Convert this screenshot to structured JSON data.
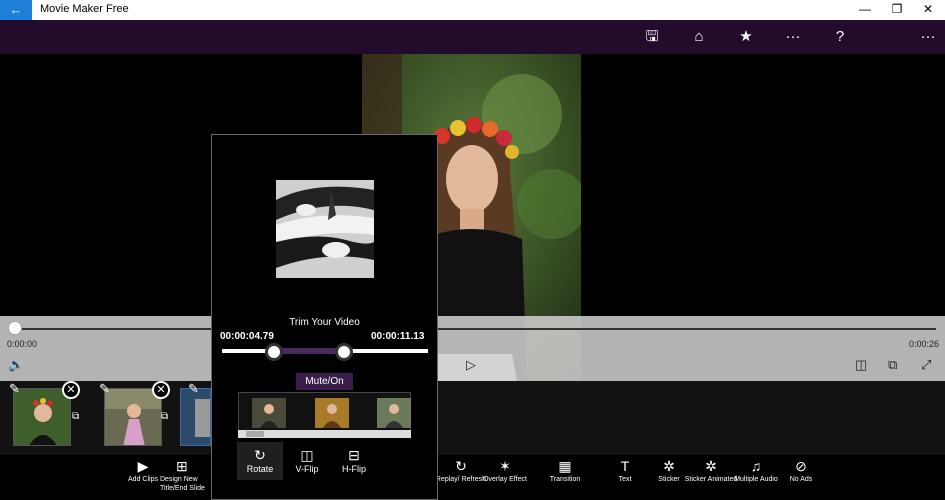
{
  "window": {
    "title": "Movie Maker Free",
    "back_icon": "←",
    "minimize": "—",
    "restore": "❐",
    "close": "✕"
  },
  "toolbar": {
    "save_icon": "🖫",
    "home_icon": "⌂",
    "star_icon": "★",
    "more_icon": "···",
    "help_icon": "?",
    "overflow_icon": "···"
  },
  "timeline": {
    "current_time": "0:00:00",
    "total_time": "0:00:26",
    "progress": 0.0,
    "volume_icon": "🔊",
    "play_icon": "▷",
    "split_icon": "◫",
    "export_icon": "⧉",
    "fullscreen_icon": "⤢"
  },
  "clips": {
    "remove_icon": "✕",
    "edit_icon": "✎",
    "copy_icon": "⧉"
  },
  "trim_dialog": {
    "title": "Trim Your Video",
    "start_time": "00:00:04.79",
    "end_time": "00:00:11.13",
    "mute_label": "Mute/On",
    "rotate_label": "Rotate",
    "vflip_label": "V-Flip",
    "hflip_label": "H-Flip",
    "rotate_icon": "↻",
    "vflip_icon": "◫",
    "hflip_icon": "⊟"
  },
  "bottom_bar": {
    "items": [
      {
        "label": "Add Clips",
        "icon": "▶"
      },
      {
        "label": "Design New Title/End Slide",
        "icon": "⊞"
      },
      {
        "label": "Replay/ Refresh",
        "icon": "↻"
      },
      {
        "label": "Overlay Effect",
        "icon": "✶"
      },
      {
        "label": "Transition",
        "icon": "▦"
      },
      {
        "label": "Text",
        "icon": "T"
      },
      {
        "label": "Sticker",
        "icon": "✲"
      },
      {
        "label": "Sticker Animated",
        "icon": "✲"
      },
      {
        "label": "Multiple Audio",
        "icon": "♫"
      },
      {
        "label": "No Ads",
        "icon": "⊘"
      }
    ]
  },
  "colors": {
    "accent_blue": "#1e7fd8",
    "toolbar_purple": "#230b2c",
    "selection_purple": "#3a1e4a"
  }
}
